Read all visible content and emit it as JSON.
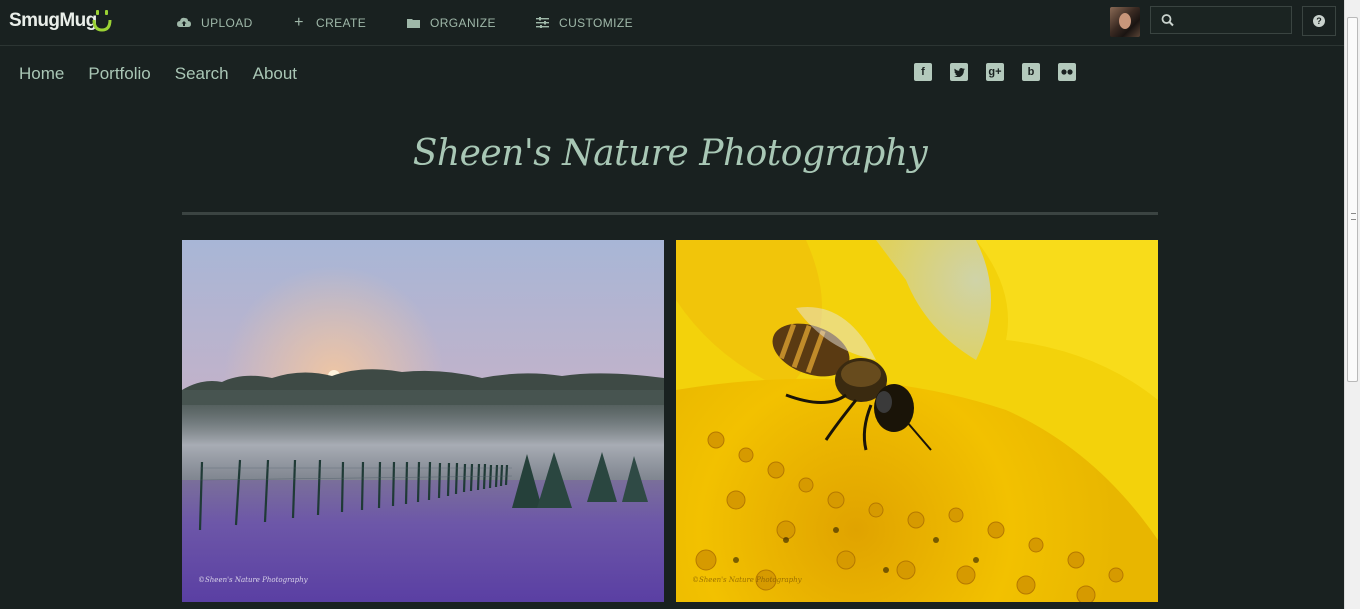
{
  "toolbar": {
    "logo_text": "SmugMug",
    "items": [
      {
        "label": "UPLOAD",
        "icon": "cloud-upload-icon"
      },
      {
        "label": "CREATE",
        "icon": "plus-icon"
      },
      {
        "label": "ORGANIZE",
        "icon": "folder-icon"
      },
      {
        "label": "CUSTOMIZE",
        "icon": "sliders-icon"
      }
    ],
    "search_placeholder": "",
    "help_label": "?"
  },
  "nav": {
    "items": [
      "Home",
      "Portfolio",
      "Search",
      "About"
    ]
  },
  "social": [
    {
      "glyph": "f",
      "icon": "facebook-icon"
    },
    {
      "glyph": "t",
      "icon": "twitter-icon"
    },
    {
      "glyph": "g+",
      "icon": "google-plus-icon"
    },
    {
      "glyph": "b",
      "icon": "blogger-icon"
    },
    {
      "glyph": "••",
      "icon": "flickr-icon"
    }
  ],
  "site": {
    "title": "Sheen's Nature Photography"
  },
  "photos": [
    {
      "watermark": "©Sheen's Nature Photography"
    },
    {
      "watermark": "©Sheen's Nature Photography"
    }
  ],
  "colors": {
    "background": "#192120",
    "accent": "#a8c7b5",
    "logo_face": "#9bd234"
  }
}
